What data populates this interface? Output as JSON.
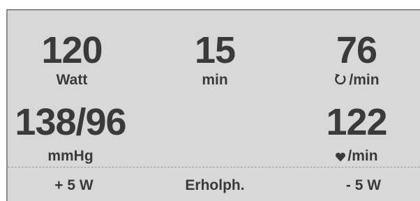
{
  "metrics": {
    "power": {
      "value": "120",
      "unit": "Watt"
    },
    "time": {
      "value": "15",
      "unit": "min"
    },
    "cadence": {
      "value": "76",
      "unit": "/min",
      "icon": "rotation-icon"
    },
    "blood_pressure": {
      "value": "138/96",
      "unit": "mmHg"
    },
    "heart_rate": {
      "value": "122",
      "unit": "/min",
      "icon": "heart-icon"
    }
  },
  "softkeys": {
    "plus": "+ 5 W",
    "recovery": "Erholph.",
    "minus": "- 5 W"
  },
  "colors": {
    "panel_background": "#d8d8d8",
    "text": "#3a3a3a",
    "border": "#8c8c8c"
  }
}
